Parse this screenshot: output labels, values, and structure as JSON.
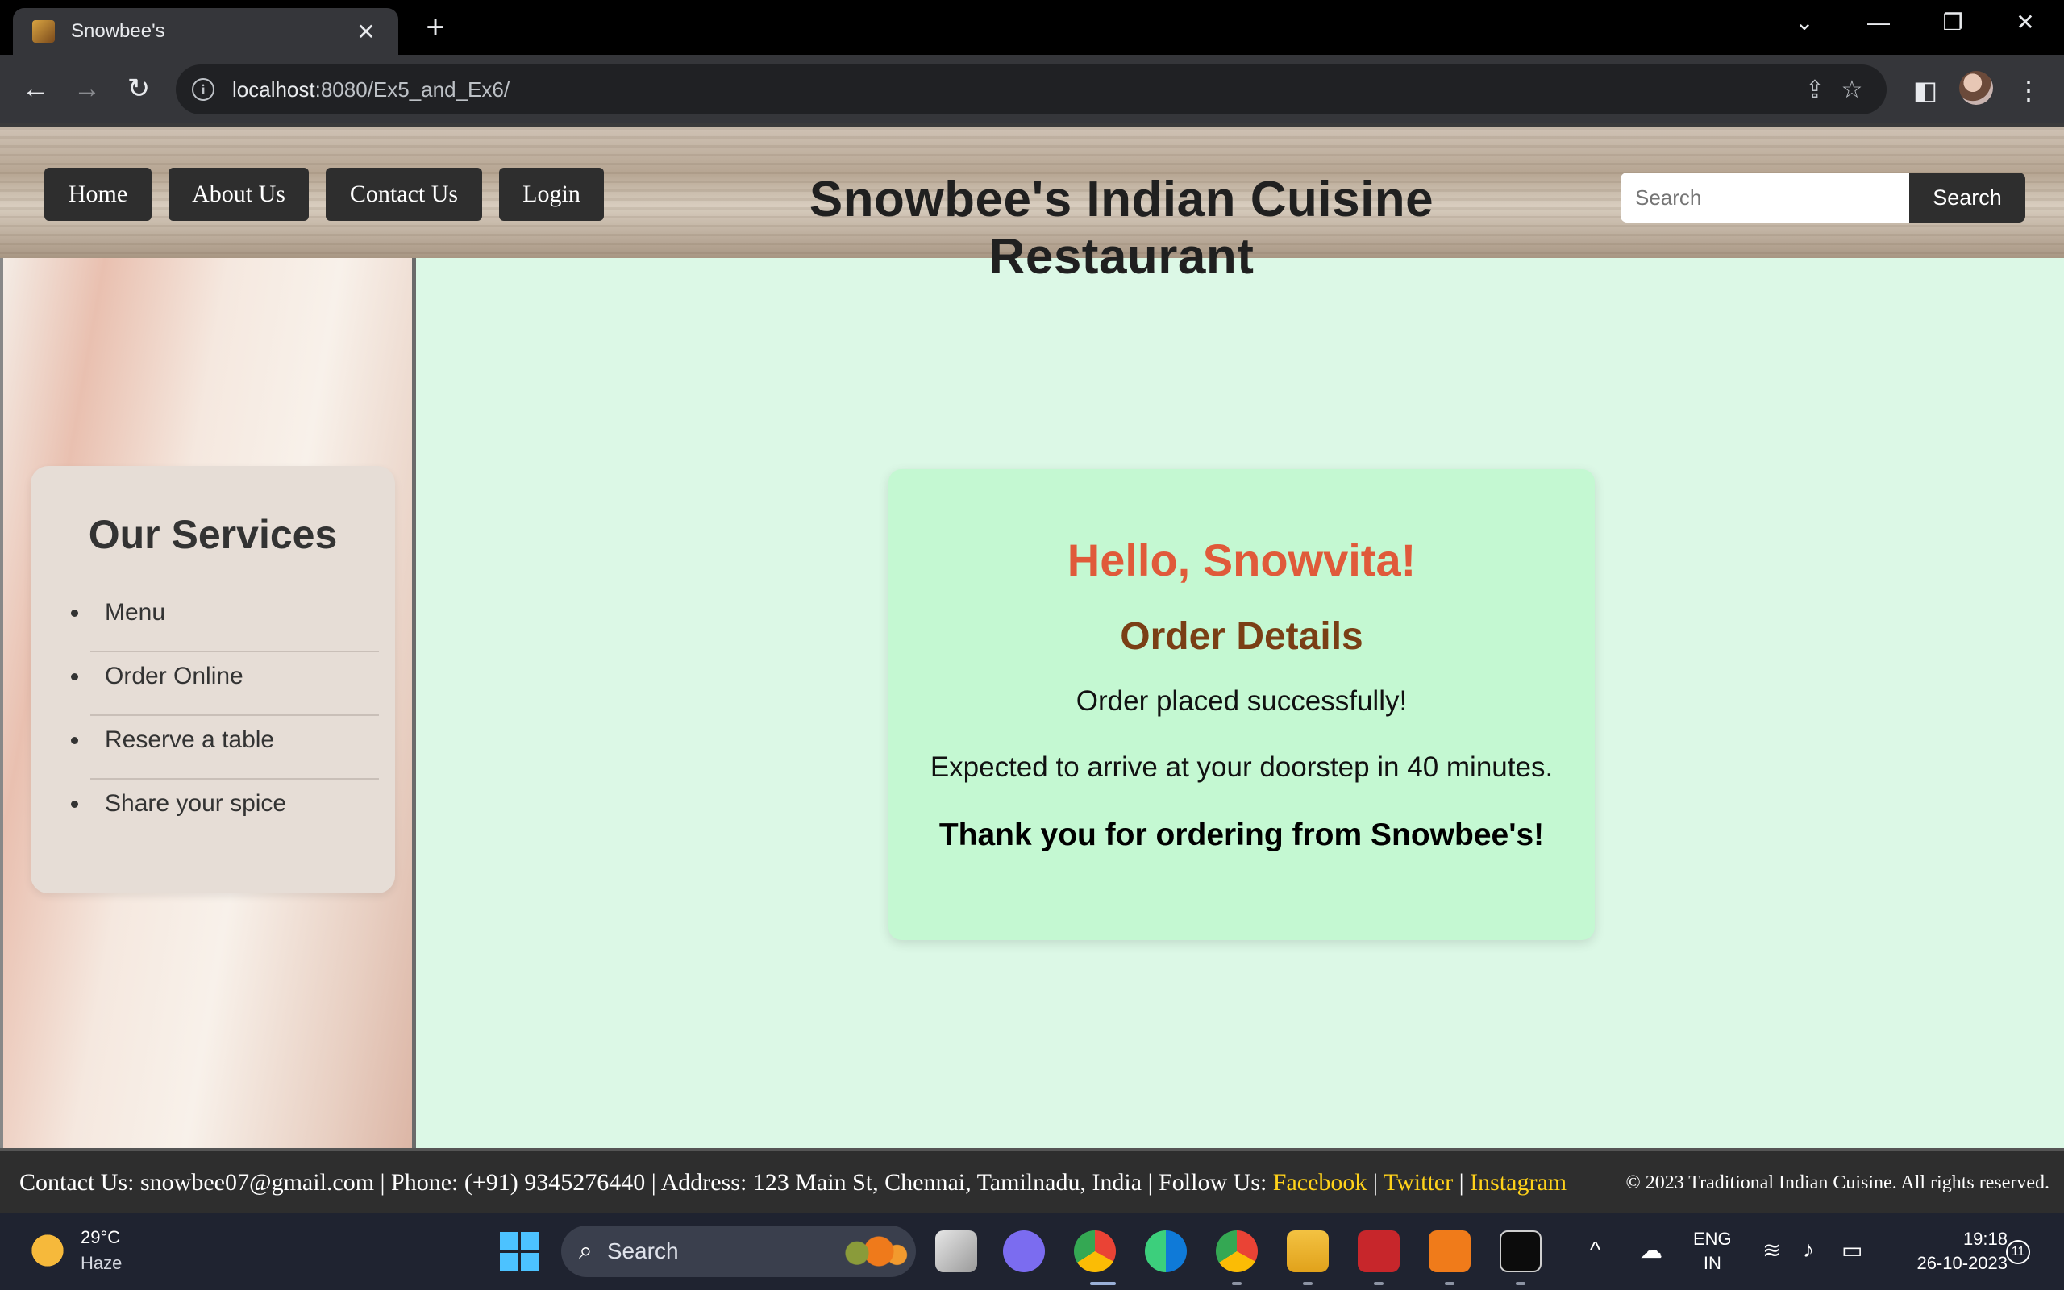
{
  "browser": {
    "tab_title": "Snowbee's",
    "tab_close": "✕",
    "new_tab": "+",
    "url_host": "localhost",
    "url_path": ":8080/Ex5_and_Ex6/",
    "window_controls": [
      "⌄",
      "—",
      "❐",
      "✕"
    ],
    "nav_icons": [
      "←",
      "→",
      "↻"
    ]
  },
  "header": {
    "nav": [
      "Home",
      "About Us",
      "Contact Us",
      "Login"
    ],
    "title": "Snowbee's Indian Cuisine Restaurant",
    "search_placeholder": "Search",
    "search_button": "Search"
  },
  "sidebar": {
    "heading": "Our Services",
    "items": [
      "Menu",
      "Order Online",
      "Reserve a table",
      "Share your spice"
    ]
  },
  "order": {
    "greeting": "Hello, Snowvita!",
    "heading": "Order Details",
    "status": "Order placed successfully!",
    "eta": "Expected to arrive at your doorstep in 40 minutes.",
    "thanks": "Thank you for ordering from Snowbee's!"
  },
  "footer": {
    "contact_prefix": "Contact Us: snowbee07@gmail.com | Phone: (+91) 9345276440 | Address: 123 Main St, Chennai, Tamilnadu, India | Follow Us: ",
    "links": [
      "Facebook",
      "Twitter",
      "Instagram"
    ],
    "separator": " | ",
    "copyright": "© 2023 Traditional Indian Cuisine. All rights reserved."
  },
  "taskbar": {
    "weather_temp": "29°C",
    "weather_condition": "Haze",
    "search_label": "Search",
    "lang_line1": "ENG",
    "lang_line2": "IN",
    "time": "19:18",
    "date": "26-10-2023",
    "notification_count": "11"
  },
  "colors": {
    "page_bg": "#dcf8e6",
    "card_bg": "#c4f8d2",
    "greeting": "#e05a3a",
    "order_heading": "#7a3f15",
    "footer_link": "#ffd21a",
    "button_dark": "#2e2e2e"
  }
}
